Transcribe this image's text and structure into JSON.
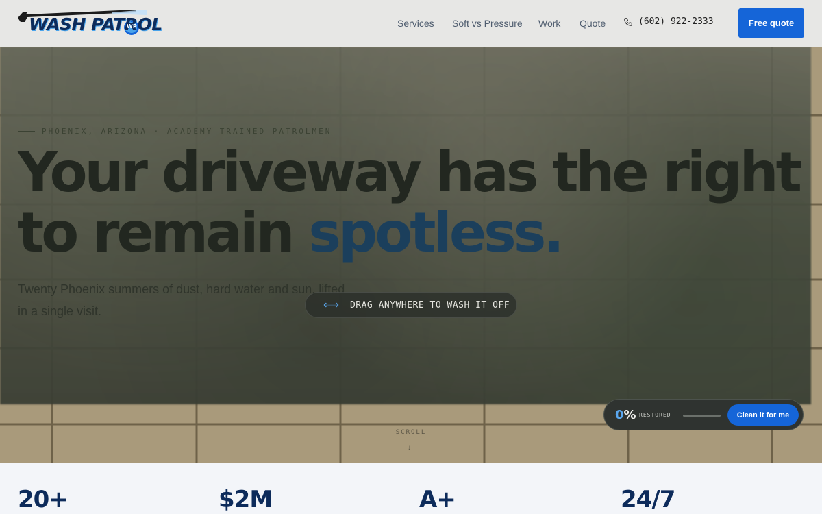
{
  "brand": {
    "name": "WASH PATROL",
    "badge": "WP"
  },
  "nav": {
    "items": [
      "Services",
      "Soft vs Pressure",
      "Work",
      "Quote"
    ],
    "phone": "(602) 922-2333",
    "cta": "Free quote"
  },
  "hero": {
    "eyebrow": "PHOENIX, ARIZONA · ACADEMY TRAINED PATROLMEN",
    "headline_line1": "Your driveway has the right",
    "headline_line2_plain": "to remain ",
    "headline_line2_accent": "spotless.",
    "subtext": "Twenty Phoenix summers of dust, hard water and sun, lifted in a single visit.",
    "drag_hint": "DRAG ANYWHERE TO WASH IT OFF",
    "scroll_label": "SCROLL",
    "scroll_arrow": "↓"
  },
  "restore": {
    "percent_number": "0",
    "percent_sign": "%",
    "progress": 0,
    "label": "RESTORED",
    "button": "Clean it for me"
  },
  "stats": [
    "20+",
    "$2M",
    "A+",
    "24/7"
  ],
  "colors": {
    "accent": "#1565d8",
    "navy": "#0d2b5b",
    "water": "#5aa7ef"
  },
  "icons": {
    "logo": "pressure-washer-icon",
    "phone": "phone-icon",
    "drag": "double-arrow-icon"
  }
}
